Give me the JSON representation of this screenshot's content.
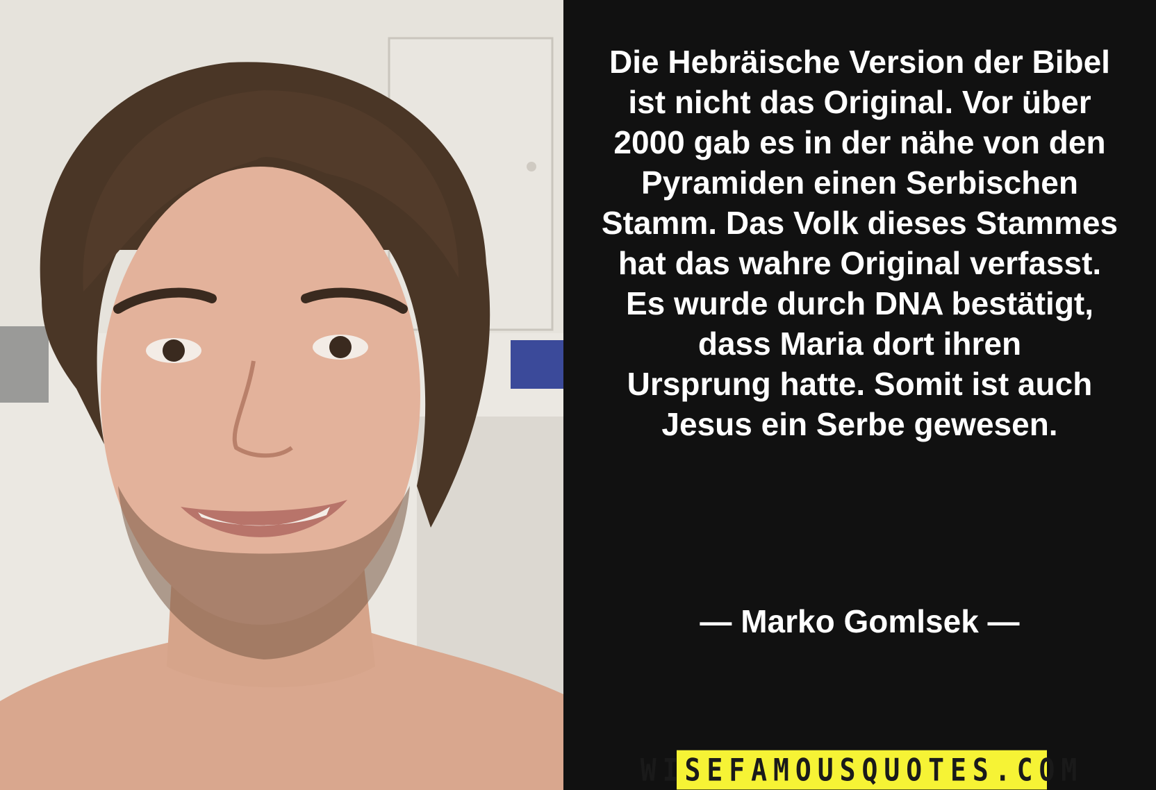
{
  "quote": {
    "text": "Die Hebräische Version der Bibel\nist nicht das Original. Vor über\n2000 gab es in der nähe von den\nPyramiden einen Serbischen\nStamm. Das Volk dieses Stammes\nhat das wahre Original verfasst.\nEs wurde durch DNA bestätigt,\ndass Maria dort ihren\nUrsprung hatte. Somit ist auch\nJesus ein Serbe gewesen.",
    "author": "— Marko Gomlsek —"
  },
  "watermark": {
    "text": "WISEFAMOUSQUOTES.COM",
    "background": "#f6f335"
  },
  "colors": {
    "panel_background": "#111111",
    "text": "#ffffff"
  },
  "photo": {
    "subject": "portrait-photo"
  }
}
